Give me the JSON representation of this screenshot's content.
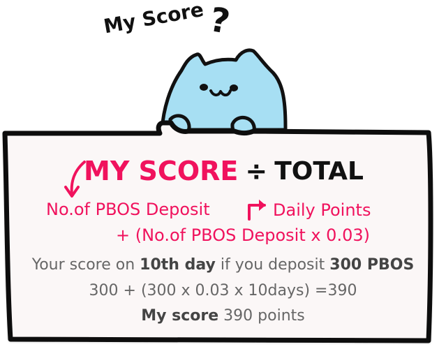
{
  "header": {
    "title": "My Score",
    "question_mark": "?"
  },
  "formula": {
    "my_score": "MY SCORE",
    "divide_symbol": "÷",
    "total": "TOTAL",
    "deposit_text": "No.of PBOS Deposit",
    "daily_points": "Daily Points",
    "paren_expression": "+ (No.of PBOS  Deposit x 0.03)"
  },
  "example": {
    "prefix": "Your score on ",
    "day": "10th day",
    "middle": " if you deposit ",
    "amount": "300 PBOS",
    "calculation": "300 + (300 x 0.03 x 10days) =390",
    "score_label": "My score",
    "score_value": "390 points"
  },
  "colors": {
    "accent_pink": "#f0125d",
    "cat_blue": "#a7dff3",
    "ink": "#111111",
    "muted_gray": "#666666"
  },
  "icons": {
    "left_arrow": "curved-down-arrow-icon",
    "right_arrow": "right-arrow-icon"
  }
}
